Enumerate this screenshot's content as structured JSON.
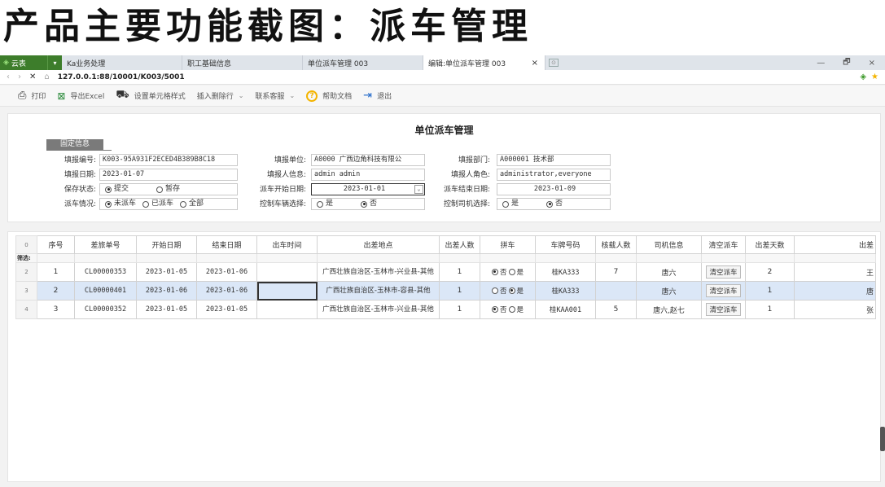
{
  "heading": "产品主要功能截图：派车管理",
  "browser": {
    "app_tab": "云表",
    "tabs": [
      {
        "label": "Ka业务处理"
      },
      {
        "label": "职工基础信息"
      },
      {
        "label": "单位派车管理 003"
      },
      {
        "label": "编辑:单位派车管理 003",
        "active": true
      }
    ],
    "close_glyph": "×",
    "url": "127.0.0.1:88/10001/K003/5001",
    "window_controls": [
      "—",
      "🗗",
      "×"
    ]
  },
  "toolbar": {
    "print": "打印",
    "export_excel": "导出Excel",
    "cell_style": "设置单元格样式",
    "insert_delete_row": "插入删除行",
    "contact_support": "联系客服",
    "help_doc": "帮助文档",
    "exit": "退出"
  },
  "form": {
    "title": "单位派车管理",
    "section_tag": "固定信息",
    "labels": {
      "report_no": "填报编号:",
      "report_unit": "填报单位:",
      "report_dept": "填报部门:",
      "report_date": "填报日期:",
      "reporter_info": "填报人信息:",
      "reporter_role": "填报人角色:",
      "save_status": "保存状态:",
      "dispatch_start": "派车开始日期:",
      "dispatch_end": "派车结束日期:",
      "dispatch_status": "派车情况:",
      "control_vehicle": "控制车辆选择:",
      "control_driver": "控制司机选择:"
    },
    "values": {
      "report_no": "K003-95A931F2ECED4B389B8C18",
      "report_unit": "A0000 广西边角科技有限公",
      "report_dept": "A000001 技术部",
      "report_date": "2023-01-07",
      "reporter_info": "admin admin",
      "reporter_role": "administrator,everyone",
      "dispatch_start": "2023-01-01",
      "dispatch_end": "2023-01-09"
    },
    "save_status_options": [
      {
        "label": "提交",
        "checked": true
      },
      {
        "label": "暂存",
        "checked": false
      }
    ],
    "dispatch_status_options": [
      {
        "label": "未派车",
        "checked": true
      },
      {
        "label": "已派车",
        "checked": false
      },
      {
        "label": "全部",
        "checked": false
      }
    ],
    "yes_no": {
      "yes": "是",
      "no": "否"
    }
  },
  "grid": {
    "corner": "0",
    "filter_label": "筛选:",
    "columns": [
      "序号",
      "差旅单号",
      "开始日期",
      "结束日期",
      "出车时间",
      "出差地点",
      "出差人数",
      "拼车",
      "车牌号码",
      "核载人数",
      "司机信息",
      "清空派车",
      "出差天数",
      "出差"
    ],
    "rows": [
      {
        "rownum": "2",
        "seq": "1",
        "order_no": "CL00000353",
        "start": "2023-01-05",
        "end": "2023-01-06",
        "depart_time": "",
        "location": "广西壮族自治区-玉林市-兴业县-其他",
        "people": "1",
        "carpool": "否",
        "plate": "桂KA333",
        "capacity": "7",
        "driver": "唐六",
        "clear_btn": "清空派车",
        "days": "2",
        "extra": "王"
      },
      {
        "rownum": "3",
        "seq": "2",
        "order_no": "CL00000401",
        "start": "2023-01-06",
        "end": "2023-01-06",
        "depart_time": "",
        "location": "广西壮族自治区-玉林市-容县-其他",
        "people": "1",
        "carpool": "是",
        "plate": "桂KA333",
        "capacity": "",
        "driver": "唐六",
        "clear_btn": "清空派车",
        "days": "1",
        "extra": "唐"
      },
      {
        "rownum": "4",
        "seq": "3",
        "order_no": "CL00000352",
        "start": "2023-01-05",
        "end": "2023-01-05",
        "depart_time": "",
        "location": "广西壮族自治区-玉林市-兴业县-其他",
        "people": "1",
        "carpool": "否",
        "plate": "桂KAA001",
        "capacity": "5",
        "driver": "唐六,赵七",
        "clear_btn": "清空派车",
        "days": "1",
        "extra": "张"
      }
    ]
  },
  "colors": {
    "app_green": "#3d7d2b",
    "selected_row": "#dbe7f7",
    "help_yellow": "#f4b400",
    "exit_blue": "#1e66c8"
  }
}
